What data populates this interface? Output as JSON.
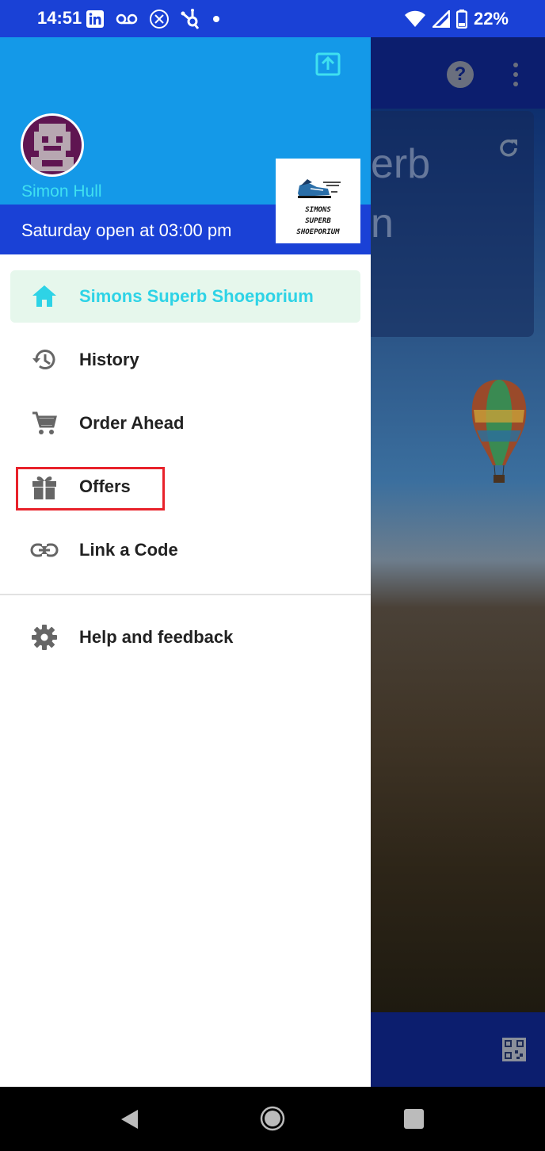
{
  "status_bar": {
    "time": "14:51",
    "battery_percent": "22%",
    "left_icons": [
      "linkedin-icon",
      "voicemail-icon",
      "circle-x-icon",
      "hubspot-icon",
      "dot-icon"
    ],
    "right_icons": [
      "wifi-icon",
      "cell-signal-icon",
      "battery-icon"
    ]
  },
  "drawer": {
    "user_name": "Simon Hull",
    "hours_text": "Saturday open at 03:00 pm",
    "logo_lines": [
      "SIMONS",
      "SUPERB",
      "SHOEPORIUM"
    ],
    "menu": [
      {
        "label": "Simons Superb Shoeporium",
        "icon": "home-icon",
        "active": true
      },
      {
        "label": "History",
        "icon": "history-icon",
        "active": false
      },
      {
        "label": "Order Ahead",
        "icon": "cart-icon",
        "active": false
      },
      {
        "label": "Offers",
        "icon": "gift-icon",
        "active": false
      },
      {
        "label": "Link a Code",
        "icon": "link-icon",
        "active": false
      },
      {
        "label": "Help and feedback",
        "icon": "gear-icon",
        "active": false
      }
    ]
  },
  "background": {
    "title_partial_1": "erb",
    "title_partial_2": "n"
  },
  "colors": {
    "status_bar": "#1a41d6",
    "drawer_header": "#1499e8",
    "accent": "#2ed3e6",
    "active_item_bg": "#e6f7ec",
    "highlight": "#e8222b"
  }
}
